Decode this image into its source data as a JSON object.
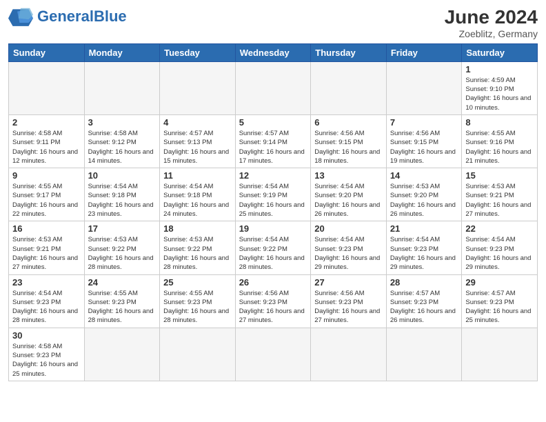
{
  "header": {
    "logo_general": "General",
    "logo_blue": "Blue",
    "month_year": "June 2024",
    "location": "Zoeblitz, Germany"
  },
  "days_of_week": [
    "Sunday",
    "Monday",
    "Tuesday",
    "Wednesday",
    "Thursday",
    "Friday",
    "Saturday"
  ],
  "weeks": [
    {
      "days": [
        {
          "date": "",
          "info": ""
        },
        {
          "date": "",
          "info": ""
        },
        {
          "date": "",
          "info": ""
        },
        {
          "date": "",
          "info": ""
        },
        {
          "date": "",
          "info": ""
        },
        {
          "date": "",
          "info": ""
        },
        {
          "date": "1",
          "info": "Sunrise: 4:59 AM\nSunset: 9:10 PM\nDaylight: 16 hours and 10 minutes."
        }
      ]
    },
    {
      "days": [
        {
          "date": "2",
          "info": "Sunrise: 4:58 AM\nSunset: 9:11 PM\nDaylight: 16 hours and 12 minutes."
        },
        {
          "date": "3",
          "info": "Sunrise: 4:58 AM\nSunset: 9:12 PM\nDaylight: 16 hours and 14 minutes."
        },
        {
          "date": "4",
          "info": "Sunrise: 4:57 AM\nSunset: 9:13 PM\nDaylight: 16 hours and 15 minutes."
        },
        {
          "date": "5",
          "info": "Sunrise: 4:57 AM\nSunset: 9:14 PM\nDaylight: 16 hours and 17 minutes."
        },
        {
          "date": "6",
          "info": "Sunrise: 4:56 AM\nSunset: 9:15 PM\nDaylight: 16 hours and 18 minutes."
        },
        {
          "date": "7",
          "info": "Sunrise: 4:56 AM\nSunset: 9:15 PM\nDaylight: 16 hours and 19 minutes."
        },
        {
          "date": "8",
          "info": "Sunrise: 4:55 AM\nSunset: 9:16 PM\nDaylight: 16 hours and 21 minutes."
        }
      ]
    },
    {
      "days": [
        {
          "date": "9",
          "info": "Sunrise: 4:55 AM\nSunset: 9:17 PM\nDaylight: 16 hours and 22 minutes."
        },
        {
          "date": "10",
          "info": "Sunrise: 4:54 AM\nSunset: 9:18 PM\nDaylight: 16 hours and 23 minutes."
        },
        {
          "date": "11",
          "info": "Sunrise: 4:54 AM\nSunset: 9:18 PM\nDaylight: 16 hours and 24 minutes."
        },
        {
          "date": "12",
          "info": "Sunrise: 4:54 AM\nSunset: 9:19 PM\nDaylight: 16 hours and 25 minutes."
        },
        {
          "date": "13",
          "info": "Sunrise: 4:54 AM\nSunset: 9:20 PM\nDaylight: 16 hours and 26 minutes."
        },
        {
          "date": "14",
          "info": "Sunrise: 4:53 AM\nSunset: 9:20 PM\nDaylight: 16 hours and 26 minutes."
        },
        {
          "date": "15",
          "info": "Sunrise: 4:53 AM\nSunset: 9:21 PM\nDaylight: 16 hours and 27 minutes."
        }
      ]
    },
    {
      "days": [
        {
          "date": "16",
          "info": "Sunrise: 4:53 AM\nSunset: 9:21 PM\nDaylight: 16 hours and 27 minutes."
        },
        {
          "date": "17",
          "info": "Sunrise: 4:53 AM\nSunset: 9:22 PM\nDaylight: 16 hours and 28 minutes."
        },
        {
          "date": "18",
          "info": "Sunrise: 4:53 AM\nSunset: 9:22 PM\nDaylight: 16 hours and 28 minutes."
        },
        {
          "date": "19",
          "info": "Sunrise: 4:54 AM\nSunset: 9:22 PM\nDaylight: 16 hours and 28 minutes."
        },
        {
          "date": "20",
          "info": "Sunrise: 4:54 AM\nSunset: 9:23 PM\nDaylight: 16 hours and 29 minutes."
        },
        {
          "date": "21",
          "info": "Sunrise: 4:54 AM\nSunset: 9:23 PM\nDaylight: 16 hours and 29 minutes."
        },
        {
          "date": "22",
          "info": "Sunrise: 4:54 AM\nSunset: 9:23 PM\nDaylight: 16 hours and 29 minutes."
        }
      ]
    },
    {
      "days": [
        {
          "date": "23",
          "info": "Sunrise: 4:54 AM\nSunset: 9:23 PM\nDaylight: 16 hours and 28 minutes."
        },
        {
          "date": "24",
          "info": "Sunrise: 4:55 AM\nSunset: 9:23 PM\nDaylight: 16 hours and 28 minutes."
        },
        {
          "date": "25",
          "info": "Sunrise: 4:55 AM\nSunset: 9:23 PM\nDaylight: 16 hours and 28 minutes."
        },
        {
          "date": "26",
          "info": "Sunrise: 4:56 AM\nSunset: 9:23 PM\nDaylight: 16 hours and 27 minutes."
        },
        {
          "date": "27",
          "info": "Sunrise: 4:56 AM\nSunset: 9:23 PM\nDaylight: 16 hours and 27 minutes."
        },
        {
          "date": "28",
          "info": "Sunrise: 4:57 AM\nSunset: 9:23 PM\nDaylight: 16 hours and 26 minutes."
        },
        {
          "date": "29",
          "info": "Sunrise: 4:57 AM\nSunset: 9:23 PM\nDaylight: 16 hours and 25 minutes."
        }
      ]
    },
    {
      "days": [
        {
          "date": "30",
          "info": "Sunrise: 4:58 AM\nSunset: 9:23 PM\nDaylight: 16 hours and 25 minutes."
        },
        {
          "date": "",
          "info": ""
        },
        {
          "date": "",
          "info": ""
        },
        {
          "date": "",
          "info": ""
        },
        {
          "date": "",
          "info": ""
        },
        {
          "date": "",
          "info": ""
        },
        {
          "date": "",
          "info": ""
        }
      ]
    }
  ]
}
